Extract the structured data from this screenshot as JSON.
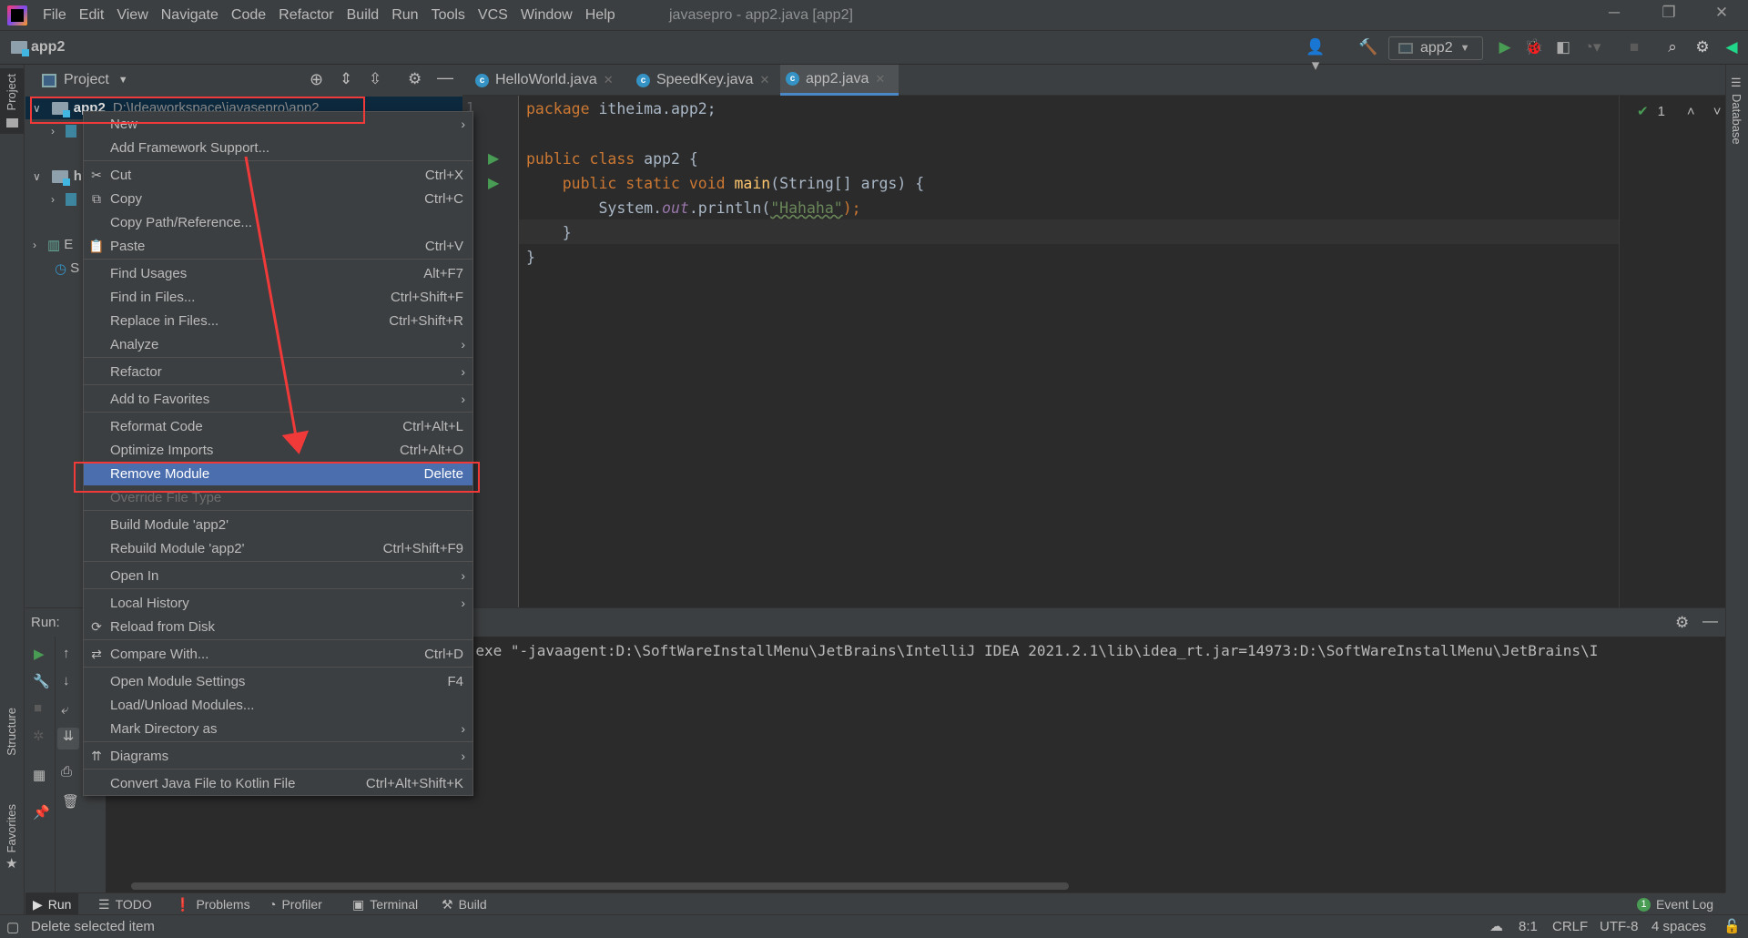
{
  "window": {
    "title": "javasepro - app2.java [app2]",
    "menu": [
      "File",
      "Edit",
      "View",
      "Navigate",
      "Code",
      "Refactor",
      "Build",
      "Run",
      "Tools",
      "VCS",
      "Window",
      "Help"
    ],
    "controls": {
      "minimize": "─",
      "restore": "❐",
      "close": "✕"
    }
  },
  "navbar": {
    "breadcrumb": "app2",
    "run_config": "app2"
  },
  "left_stripe": {
    "project": "Project",
    "structure": "Structure",
    "favorites": "Favorites"
  },
  "right_stripe": {
    "database": "Database"
  },
  "project_panel": {
    "title": "Project",
    "tree": [
      {
        "name": "app2",
        "path": "D:\\Ideaworkspace\\javasepro\\app2",
        "selected": true
      },
      {
        "name": "h"
      },
      {
        "name": "E"
      },
      {
        "name": "S"
      }
    ]
  },
  "editor": {
    "tabs": [
      {
        "label": "HelloWorld.java",
        "active": false
      },
      {
        "label": "SpeedKey.java",
        "active": false
      },
      {
        "label": "app2.java",
        "active": true
      }
    ],
    "line_number_visible": "1",
    "inspection_count": "1",
    "code": {
      "l1_kw": "package",
      "l1_rest": " itheima.app2;",
      "l3_kw": "public class",
      "l3_rest": " app2 {",
      "l4_kw": "public static void",
      "l4_fn": "main",
      "l4_rest": "(String[] args) {",
      "l5_a": "System.",
      "l5_out": "out",
      "l5_b": ".println(",
      "l5_str": "\"Hahaha\"",
      "l5_c": ");",
      "l6": "}",
      "l7": "}"
    }
  },
  "run_panel": {
    "label": "Run:",
    "console_line": "\\bin\\java.exe \"-javaagent:D:\\SoftWareInstallMenu\\JetBrains\\IntelliJ IDEA 2021.2.1\\lib\\idea_rt.jar=14973:D:\\SoftWareInstallMenu\\JetBrains\\I"
  },
  "context_menu": {
    "items": [
      {
        "label": "New",
        "submenu": true,
        "sep": false
      },
      {
        "label": "Add Framework Support...",
        "sep": true
      },
      {
        "label": "Cut",
        "shortcut": "Ctrl+X",
        "icon": "✂",
        "icon_name": "scissors-icon"
      },
      {
        "label": "Copy",
        "shortcut": "Ctrl+C",
        "icon": "⧉",
        "icon_name": "copy-icon"
      },
      {
        "label": "Copy Path/Reference..."
      },
      {
        "label": "Paste",
        "shortcut": "Ctrl+V",
        "icon": "📋",
        "icon_name": "clipboard-icon",
        "sep": true
      },
      {
        "label": "Find Usages",
        "shortcut": "Alt+F7"
      },
      {
        "label": "Find in Files...",
        "shortcut": "Ctrl+Shift+F"
      },
      {
        "label": "Replace in Files...",
        "shortcut": "Ctrl+Shift+R"
      },
      {
        "label": "Analyze",
        "submenu": true,
        "sep": true
      },
      {
        "label": "Refactor",
        "submenu": true,
        "sep": true
      },
      {
        "label": "Add to Favorites",
        "submenu": true,
        "sep": true
      },
      {
        "label": "Reformat Code",
        "shortcut": "Ctrl+Alt+L"
      },
      {
        "label": "Optimize Imports",
        "shortcut": "Ctrl+Alt+O"
      },
      {
        "label": "Remove Module",
        "shortcut": "Delete",
        "highlighted": true
      },
      {
        "label": "Override File Type",
        "disabled": true,
        "sep": true
      },
      {
        "label": "Build Module 'app2'"
      },
      {
        "label": "Rebuild Module 'app2'",
        "shortcut": "Ctrl+Shift+F9",
        "sep": true
      },
      {
        "label": "Open In",
        "submenu": true,
        "sep": true
      },
      {
        "label": "Local History",
        "submenu": true
      },
      {
        "label": "Reload from Disk",
        "icon": "⟳",
        "icon_name": "reload-icon",
        "sep": true
      },
      {
        "label": "Compare With...",
        "shortcut": "Ctrl+D",
        "icon": "⇄",
        "icon_name": "compare-icon",
        "sep": true
      },
      {
        "label": "Open Module Settings",
        "shortcut": "F4"
      },
      {
        "label": "Load/Unload Modules..."
      },
      {
        "label": "Mark Directory as",
        "submenu": true,
        "sep": true
      },
      {
        "label": "Diagrams",
        "submenu": true,
        "icon": "⇈",
        "icon_name": "diagram-icon",
        "sep": true
      },
      {
        "label": "Convert Java File to Kotlin File",
        "shortcut": "Ctrl+Alt+Shift+K"
      }
    ]
  },
  "bottom_tabs": [
    "Run",
    "TODO",
    "Problems",
    "Profiler",
    "Terminal",
    "Build"
  ],
  "event_log": {
    "count": "1",
    "label": "Event Log"
  },
  "status_bar": {
    "message": "Delete selected item",
    "position": "8:1",
    "line_sep": "CRLF",
    "encoding": "UTF-8",
    "indent": "4 spaces"
  },
  "colors": {
    "accent": "#4b6eaf",
    "annotation": "#f03a3a",
    "run_green": "#499c54",
    "tab_underline": "#4a88c7"
  }
}
